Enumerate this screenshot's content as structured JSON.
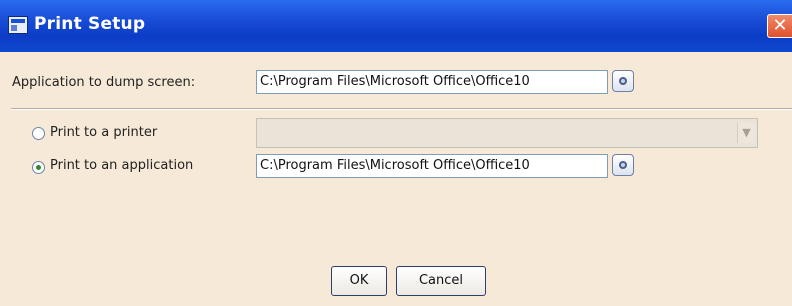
{
  "window": {
    "title": "Print Setup",
    "close_glyph": "✕"
  },
  "dump": {
    "label": "Application to dump screen:",
    "value": "C:\\Program Files\\Microsoft Office\\Office10"
  },
  "options": {
    "printer_label": "Print to a printer",
    "printer_selected": false,
    "printer_value": "",
    "application_label": "Print to an application",
    "application_selected": true,
    "application_value": "C:\\Program Files\\Microsoft Office\\Office10"
  },
  "buttons": {
    "ok": "OK",
    "cancel": "Cancel"
  },
  "icons": {
    "app": "window-app-icon",
    "browse": "browse-icon",
    "dropdown": "chevron-down-icon",
    "close": "close-icon"
  }
}
